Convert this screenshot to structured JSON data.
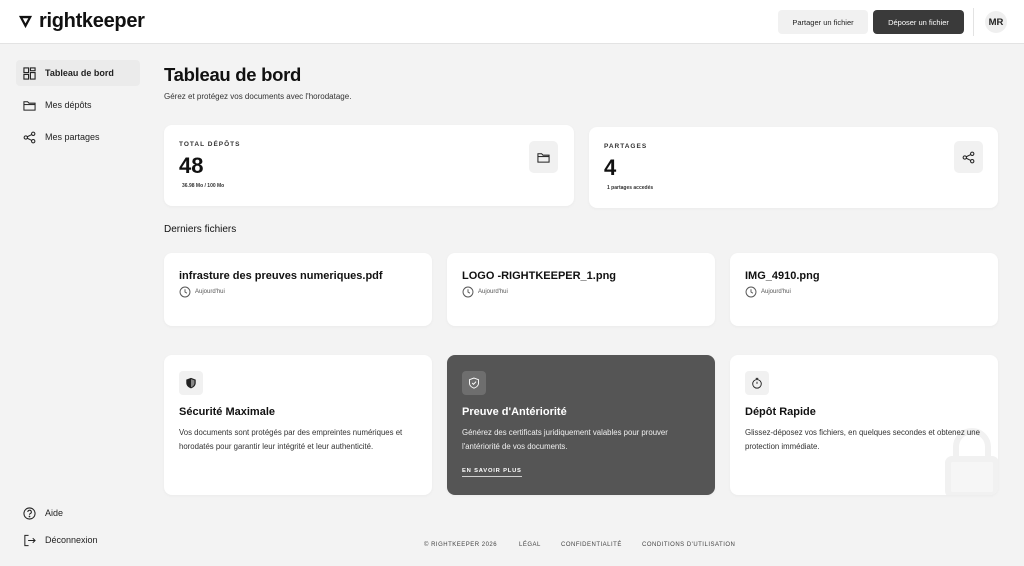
{
  "header": {
    "brand": "rightkeeper",
    "share_button": "Partager un fichier",
    "upload_button": "Déposer un fichier",
    "avatar_initials": "MR"
  },
  "sidebar": {
    "items": [
      {
        "label": "Tableau de bord",
        "icon": "dashboard-icon",
        "active": true
      },
      {
        "label": "Mes dépôts",
        "icon": "folder-icon"
      },
      {
        "label": "Mes partages",
        "icon": "share-icon"
      }
    ],
    "bottom": [
      {
        "label": "Aide",
        "icon": "help-icon"
      },
      {
        "label": "Déconnexion",
        "icon": "logout-icon"
      }
    ]
  },
  "main": {
    "title": "Tableau de bord",
    "subtitle": "Gérez et protégez vos documents avec l'horodatage.",
    "stats": [
      {
        "label": "TOTAL DÉPÔTS",
        "value": "48",
        "sub": "36.98 Mo / 100 Mo",
        "icon": "folder-icon"
      },
      {
        "label": "PARTAGES",
        "value": "4",
        "sub": "1 partages accedés",
        "icon": "share-icon"
      }
    ],
    "recent_title": "Derniers fichiers",
    "recent_files": [
      {
        "name": "infrasture des preuves numeriques.pdf",
        "date": "Aujourd'hui"
      },
      {
        "name": "LOGO -RIGHTKEEPER_1.png",
        "date": "Aujourd'hui"
      },
      {
        "name": "IMG_4910.png",
        "date": "Aujourd'hui"
      }
    ],
    "features": [
      {
        "title": "Sécurité Maximale",
        "text": "Vos documents sont protégés par des empreintes numériques et horodatés pour garantir leur intégrité et leur authenticité.",
        "icon": "shield-icon"
      },
      {
        "title": "Preuve d'Antériorité",
        "text": "Générez des certificats juridiquement valables pour prouver l'antériorité de vos documents.",
        "icon": "shield-check-icon",
        "link": "EN SAVOIR PLUS"
      },
      {
        "title": "Dépôt Rapide",
        "text": "Glissez-déposez vos fichiers, en quelques secondes et obtenez une protection immédiate.",
        "icon": "stopwatch-icon"
      }
    ]
  },
  "footer": {
    "copyright": "© RIGHTKEEPER 2026",
    "links": [
      "LÉGAL",
      "CONFIDENTIALITÉ",
      "CONDITIONS D'UTILISATION"
    ]
  },
  "colors": {
    "background": "#f3f3f3",
    "card": "#ffffff",
    "dark_card": "#555555",
    "primary_button": "#3a3a3a"
  }
}
